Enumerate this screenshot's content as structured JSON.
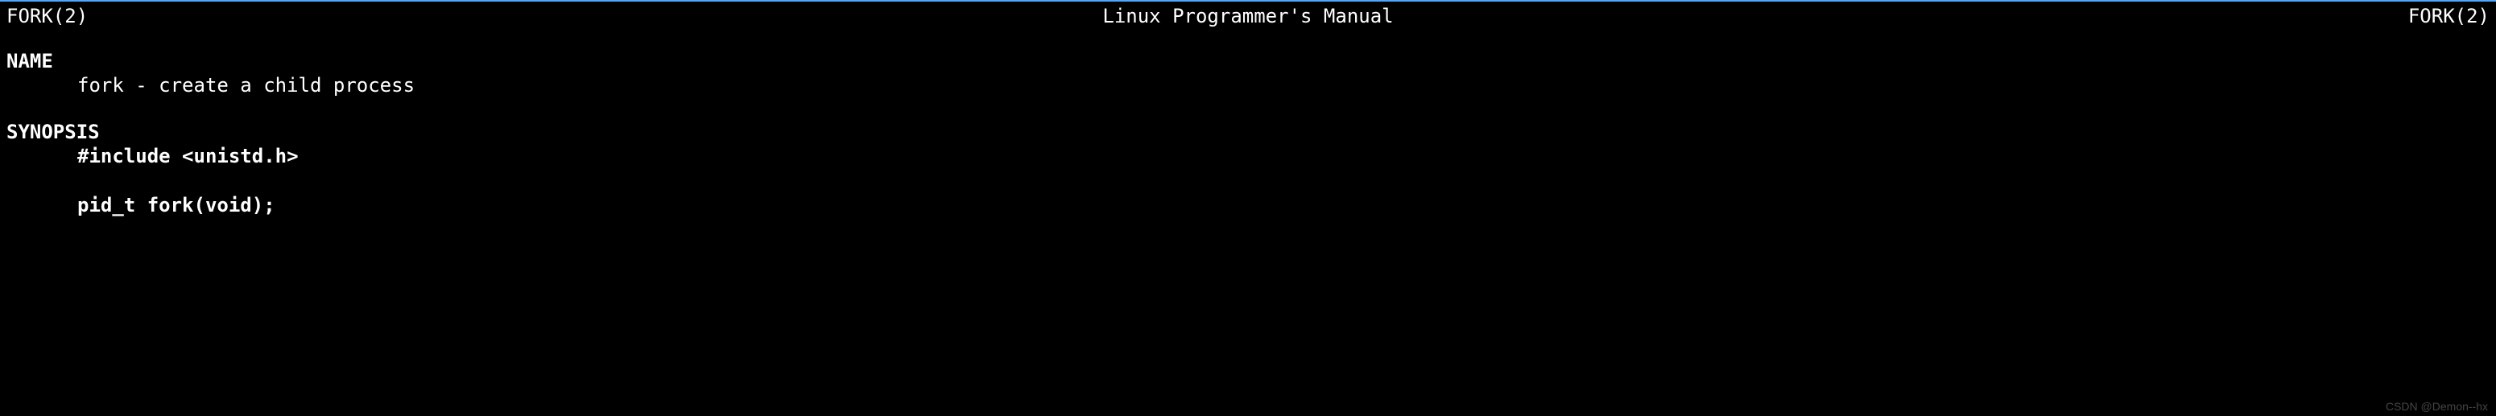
{
  "header": {
    "left": "FORK(2)",
    "center": "Linux Programmer's Manual",
    "right": "FORK(2)"
  },
  "sections": {
    "name": {
      "heading": "NAME",
      "body": "fork - create a child process"
    },
    "synopsis": {
      "heading": "SYNOPSIS",
      "include": "#include <unistd.h>",
      "prototype": "pid_t fork(void);"
    }
  },
  "watermark": "CSDN @Demon--hx"
}
